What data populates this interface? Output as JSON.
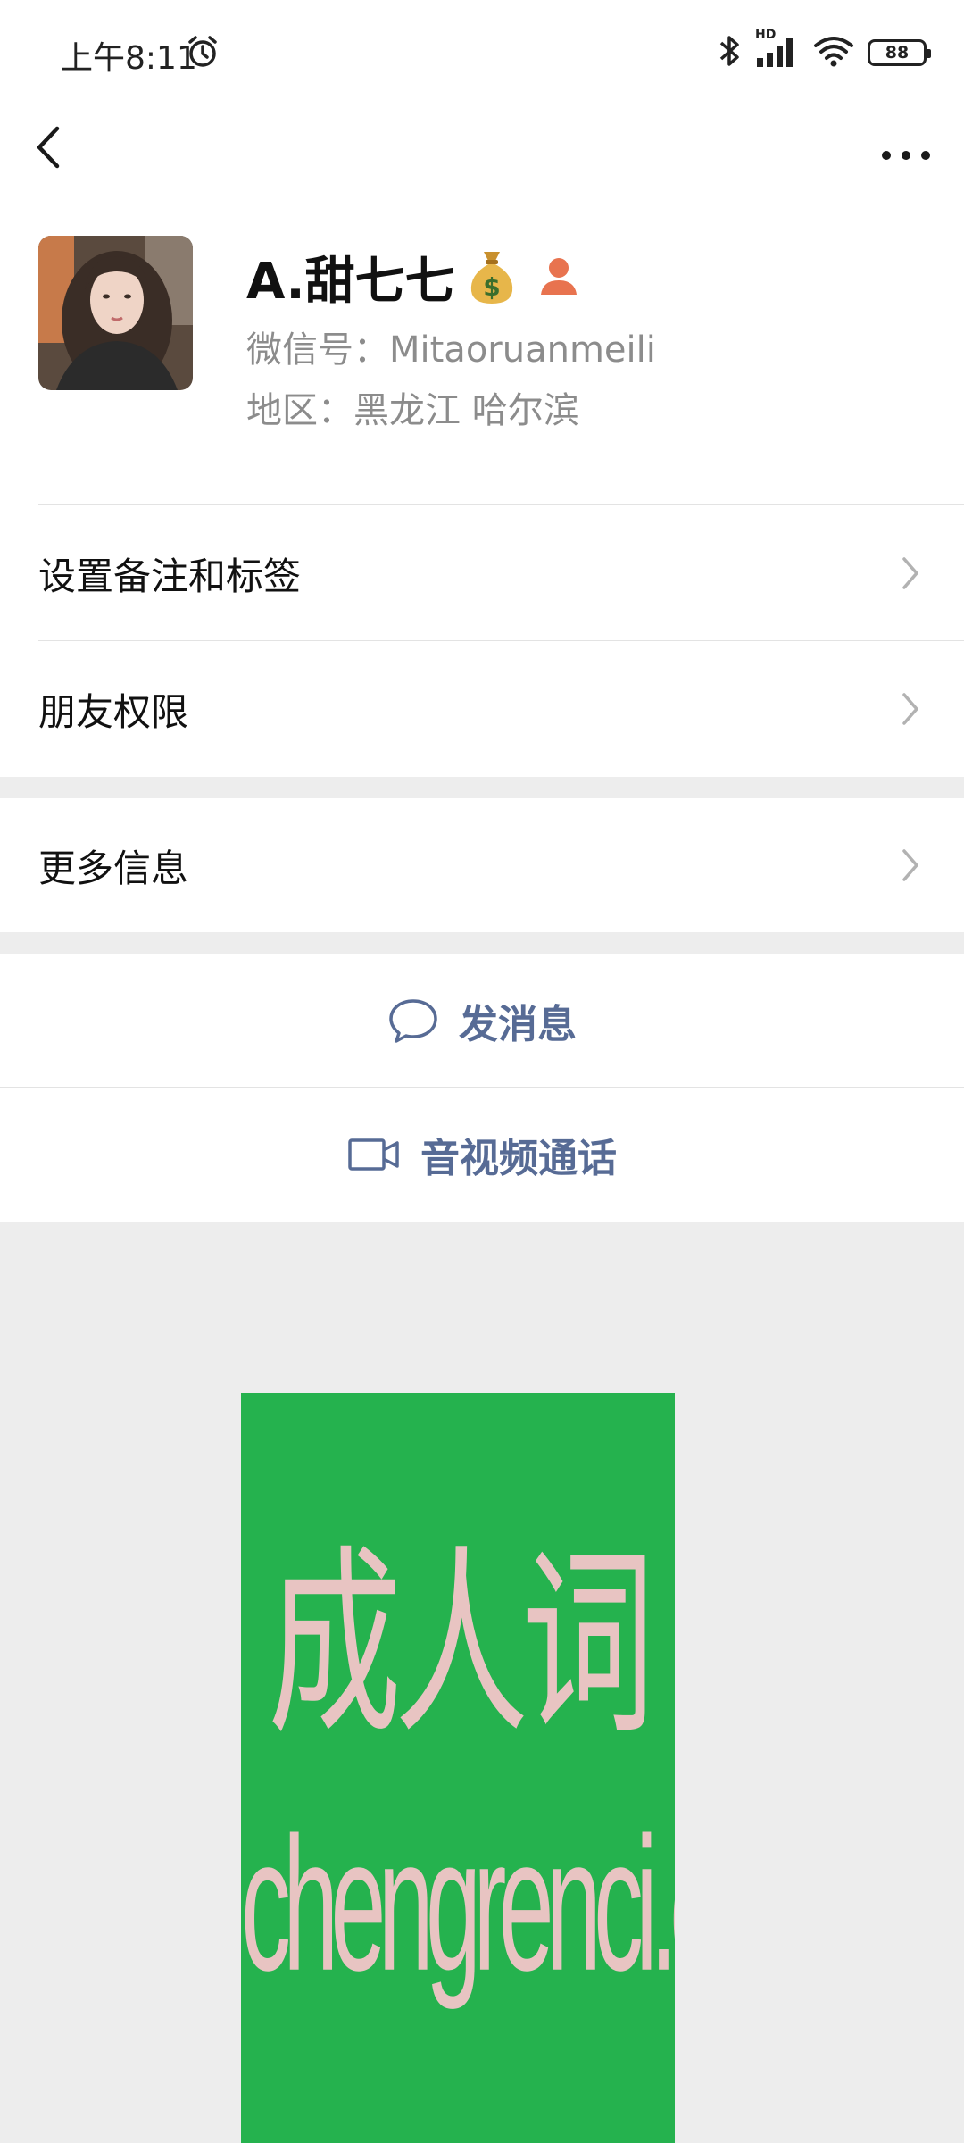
{
  "status_bar": {
    "time": "上午8:11",
    "network_label": "HD",
    "battery": "88"
  },
  "icons": {
    "back": "chevron-left-icon",
    "more": "more-dots-icon",
    "alarm": "alarm-icon",
    "bluetooth": "bluetooth-icon",
    "signal": "signal-icon",
    "wifi": "wifi-icon",
    "battery": "battery-icon",
    "money_badge": "money-bag-icon",
    "user_badge": "user-icon",
    "message": "chat-bubble-icon",
    "video": "video-camera-icon"
  },
  "profile": {
    "name": "A.甜七七",
    "wechat_id": "微信号：Mitaoruanmeili",
    "region": "地区：黑龙江  哈尔滨"
  },
  "menu": {
    "remark_tags": "设置备注和标签",
    "friend_permissions": "朋友权限",
    "more_info": "更多信息"
  },
  "actions": {
    "send_message": "发消息",
    "av_call": "音视频通话"
  },
  "ad": {
    "title_cn": "成人词",
    "domain": "chengrenci.com"
  },
  "colors": {
    "link_blue": "#576b95",
    "ad_green": "#25b24e",
    "ad_text": "#e8c4c2",
    "user_badge": "#e8734f",
    "background": "#ededed"
  }
}
